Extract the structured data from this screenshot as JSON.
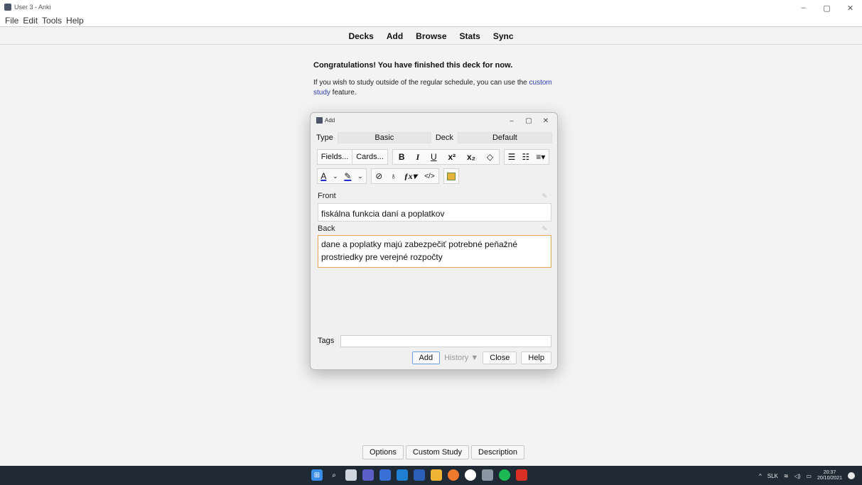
{
  "window": {
    "title": "User 3 - Anki",
    "controls": [
      "–",
      "▢",
      "✕"
    ]
  },
  "menu": [
    "File",
    "Edit",
    "Tools",
    "Help"
  ],
  "toolbar": [
    "Decks",
    "Add",
    "Browse",
    "Stats",
    "Sync"
  ],
  "congrats": {
    "heading": "Congratulations! You have finished this deck for now.",
    "text_before": "If you wish to study outside of the regular schedule, you can use the ",
    "link": "custom study",
    "text_after": " feature."
  },
  "dialog": {
    "title": "Add",
    "type_label": "Type",
    "type_value": "Basic",
    "deck_label": "Deck",
    "deck_value": "Default",
    "fields_button": "Fields...",
    "cards_button": "Cards...",
    "front_label": "Front",
    "front_value": "fiskálna funkcia daní a poplatkov",
    "back_label": "Back",
    "back_value": "dane a poplatky majú zabezpečiť potrebné peňažné prostriedky pre verejné rozpočty",
    "tags_label": "Tags",
    "tags_value": "",
    "add_button": "Add",
    "history_button": "History ▼",
    "close_button": "Close",
    "help_button": "Help"
  },
  "bottom_buttons": [
    "Options",
    "Custom Study",
    "Description"
  ],
  "taskbar": {
    "tray_lang": "SLK",
    "time": "20:37",
    "date": "20/10/2021",
    "colors": {
      "bg": "#1f2a35"
    }
  }
}
